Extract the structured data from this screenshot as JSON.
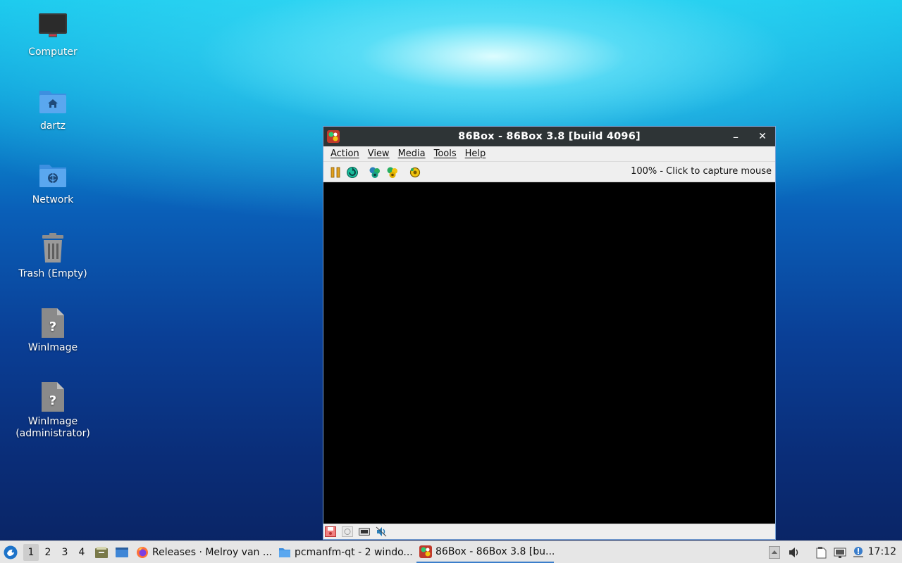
{
  "desktop": {
    "icons": [
      {
        "label": "Computer",
        "icon": "computer-icon"
      },
      {
        "label": "dartz",
        "icon": "home-folder-icon"
      },
      {
        "label": "Network",
        "icon": "network-folder-icon"
      },
      {
        "label": "Trash (Empty)",
        "icon": "trash-icon"
      },
      {
        "label": "WinImage",
        "icon": "unknown-file-icon"
      },
      {
        "label": "WinImage\n(administrator)",
        "icon": "unknown-file-icon"
      }
    ]
  },
  "window": {
    "title": "86Box - 86Box 3.8 [build 4096]",
    "controls": {
      "minimize": "–",
      "close": "✕"
    },
    "menu": [
      "Action",
      "View",
      "Media",
      "Tools",
      "Help"
    ],
    "toolbar": {
      "buttons": [
        "pause-icon",
        "hard-reset-icon",
        "ctrl-alt-del-icon",
        "ctrl-alt-esc-icon",
        "settings-icon"
      ],
      "status": "100% - Click to capture mouse"
    },
    "statusbar": [
      "floppy-icon",
      "cdrom-icon",
      "network-card-icon",
      "sound-icon"
    ]
  },
  "taskbar": {
    "workspaces": [
      "1",
      "2",
      "3",
      "4"
    ],
    "active_workspace": "1",
    "tasks": [
      {
        "label": "Releases · Melroy van ...",
        "icon": "firefox-icon"
      },
      {
        "label": "pcmanfm-qt - 2 windo...",
        "icon": "folder-icon"
      },
      {
        "label": "86Box - 86Box 3.8 [bu...",
        "icon": "86box-icon"
      }
    ],
    "clock": "17:12"
  },
  "colors": {
    "titlebar": "#2e3436",
    "taskbar": "#e6e6e6",
    "accent": "#3b7ecb"
  }
}
